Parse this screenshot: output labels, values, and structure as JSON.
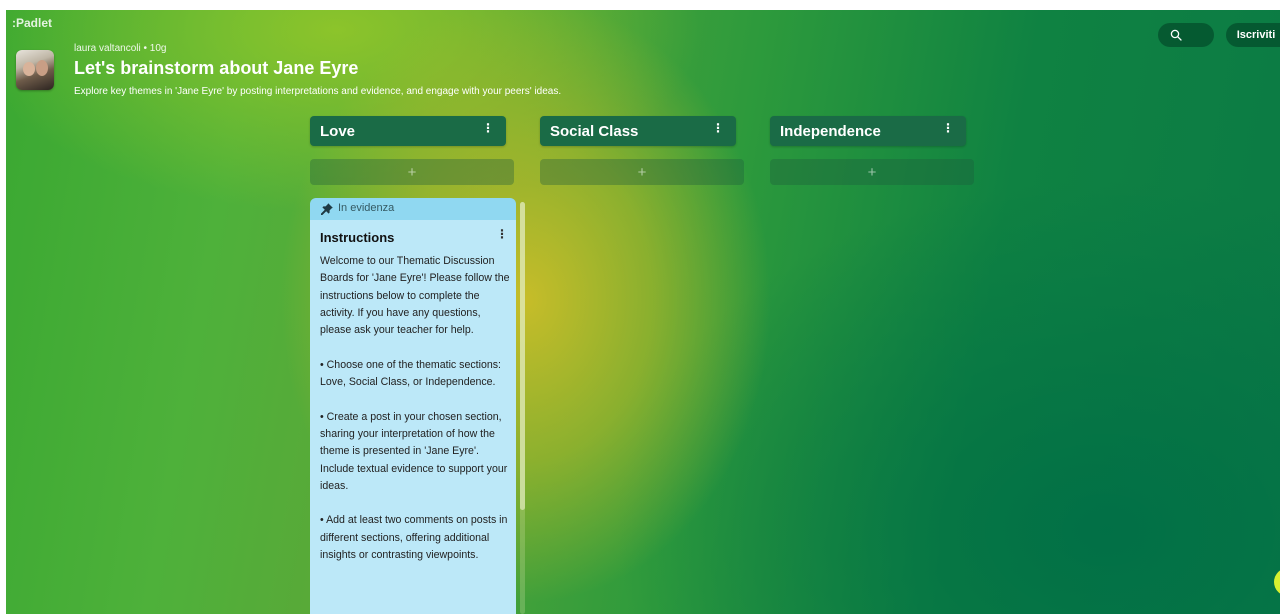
{
  "app": {
    "brand": ":Padlet"
  },
  "header": {
    "author": "laura valtancoli",
    "separator": "•",
    "age": "10g",
    "title": "Let's brainstorm about Jane Eyre",
    "description": "Explore key themes in 'Jane Eyre' by posting interpretations and evidence, and engage with your peers' ideas."
  },
  "toolbar": {
    "search_icon": "search-icon",
    "subscribe_label": "Iscriviti"
  },
  "columns": [
    {
      "title": "Love",
      "menu_glyph": "⋮",
      "add_glyph": "+"
    },
    {
      "title": "Social Class",
      "menu_glyph": "⋮",
      "add_glyph": "+"
    },
    {
      "title": "Independence",
      "menu_glyph": "⋮",
      "add_glyph": "+"
    }
  ],
  "pinned_post": {
    "pinned_label": "In evidenza",
    "pin_icon": "pin-icon",
    "title": "Instructions",
    "menu_glyph": "⋮",
    "paragraphs": [
      "Welcome to our Thematic Discussion Boards for 'Jane Eyre'! Please follow the instructions below to complete the activity. If you have any questions, please ask your teacher for help.",
      "• Choose one of the thematic sections: Love, Social Class, or Independence.",
      "• Create a post in your chosen section, sharing your interpretation of how the theme is presented in 'Jane Eyre'. Include textual evidence to support your ideas.",
      "• Add at least two comments on posts in different sections, offering additional insights or contrasting viewpoints."
    ]
  },
  "colors": {
    "column_header": "#1a6b46",
    "post_background": "#bce8f8",
    "pinned_bar": "#90d8f1",
    "accent": "#d8f030"
  }
}
